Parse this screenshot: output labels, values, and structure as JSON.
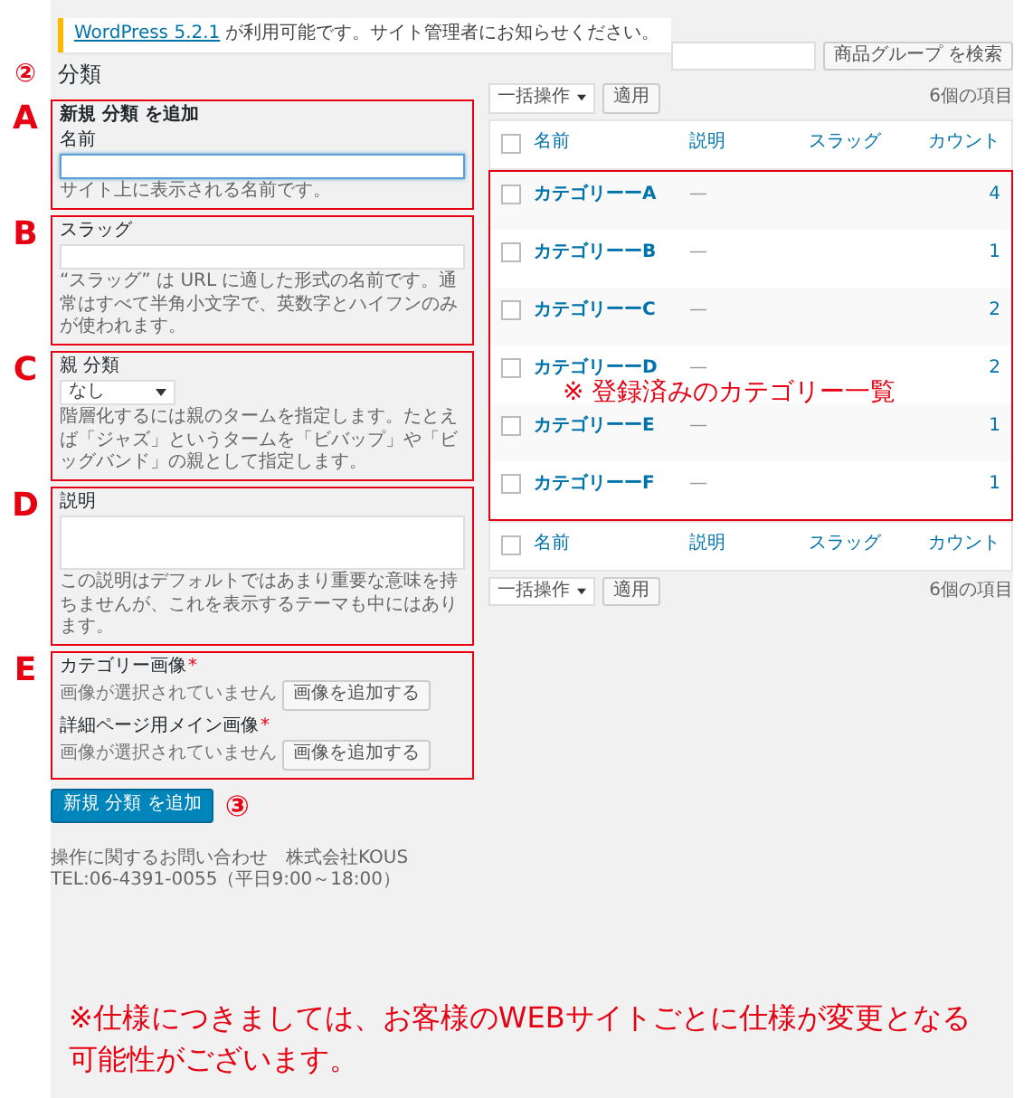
{
  "notice": {
    "link": "WordPress 5.2.1",
    "text": "が利用可能です。サイト管理者にお知らせください。"
  },
  "page_title": {
    "text": "分類",
    "marker": "②"
  },
  "form": {
    "title": "新規 分類 を追加",
    "sections": [
      {
        "marker": "A",
        "kind": "input",
        "label": "名前",
        "help": "サイト上に表示される名前です。",
        "focused": true
      },
      {
        "marker": "B",
        "kind": "input",
        "label": "スラッグ",
        "help": "“スラッグ” は URL に適した形式の名前です。通常はすべて半角小文字で、英数字とハイフンのみが使われます。",
        "focused": false
      },
      {
        "marker": "C",
        "kind": "select",
        "label": "親 分類",
        "value": "なし",
        "help": "階層化するには親のタームを指定します。たとえば「ジャズ」というタームを「ビバップ」や「ビッグバンド」の親として指定します。"
      },
      {
        "marker": "D",
        "kind": "textarea",
        "label": "説明",
        "help": "この説明はデフォルトではあまり重要な意味を持ちませんが、これを表示するテーマも中にはあります。"
      },
      {
        "marker": "E",
        "kind": "images",
        "fields": [
          {
            "label": "カテゴリー画像",
            "required_mark": "*",
            "status": "画像が選択されていません",
            "button": "画像を追加する"
          },
          {
            "label": "詳細ページ用メイン画像",
            "required_mark": "*",
            "status": "画像が選択されていません",
            "button": "画像を追加する"
          }
        ]
      }
    ],
    "submit": "新規 分類 を追加",
    "submit_marker": "③"
  },
  "footer": "操作に関するお問い合わせ　株式会社KOUS　TEL:06-4391-0055（平日9:00～18:00）",
  "search": {
    "button": "商品グループ を検索"
  },
  "top_nav": {
    "bulk": "一括操作",
    "apply": "適用",
    "count": "6個の項目"
  },
  "bottom_nav": {
    "bulk": "一括操作",
    "apply": "適用",
    "count": "6個の項目"
  },
  "table": {
    "columns": [
      "名前",
      "説明",
      "スラッグ",
      "カウント"
    ],
    "footer_columns": [
      "名前",
      "説明",
      "スラッグ",
      "カウント"
    ],
    "header_checked": false,
    "footer_checked": false,
    "rows": [
      {
        "name": "カテゴリーーA",
        "description": "—",
        "count": "4",
        "checked": false
      },
      {
        "name": "カテゴリーーB",
        "description": "—",
        "count": "1",
        "checked": false
      },
      {
        "name": "カテゴリーーC",
        "description": "—",
        "count": "2",
        "checked": false
      },
      {
        "name": "カテゴリーーD",
        "description": "—",
        "count": "2",
        "checked": false
      },
      {
        "name": "カテゴリーーE",
        "description": "—",
        "count": "1",
        "checked": false
      },
      {
        "name": "カテゴリーーF",
        "description": "—",
        "count": "1",
        "checked": false
      }
    ],
    "annotation": "※ 登録済みのカテゴリー一覧"
  },
  "bottom_note": "※仕様につきましては、お客様のWEBサイトごとに仕様が変更となる可能性がございます。"
}
